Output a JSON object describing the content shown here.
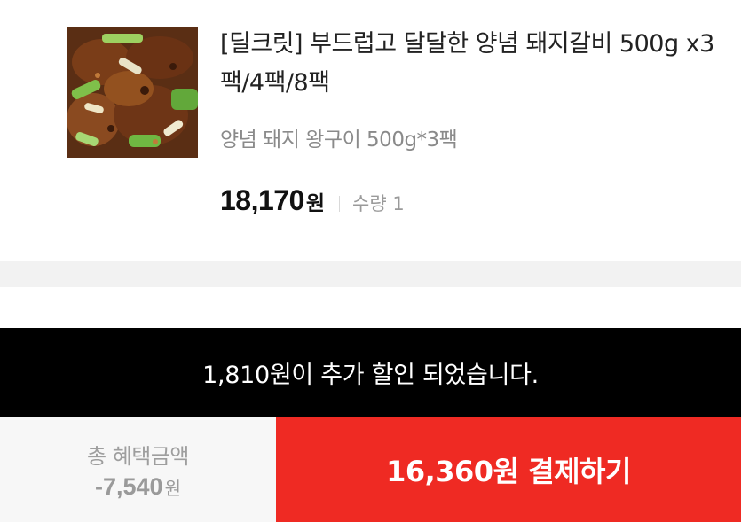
{
  "product": {
    "image_icon": "marinated-pork-galbi-photo",
    "title": "[딜크릿] 부드럽고 달달한 양념 돼지갈비 500g x3팩/4팩/8팩",
    "option": "양념 돼지 왕구이 500g*3팩",
    "price": "18,170",
    "price_unit": "원",
    "quantity": "수량 1"
  },
  "toast": {
    "message": "1,810원이 추가 할인 되었습니다."
  },
  "bottom_bar": {
    "benefit_label": "총 혜택금액",
    "benefit_amount": "-7,540",
    "benefit_unit": "원",
    "pay_label": "16,360원 결제하기"
  },
  "colors": {
    "pay_button": "#ef2a23",
    "toast_bg": "#000000",
    "benefit_bg": "#f7f7f7",
    "gap_band": "#f2f2f2"
  }
}
